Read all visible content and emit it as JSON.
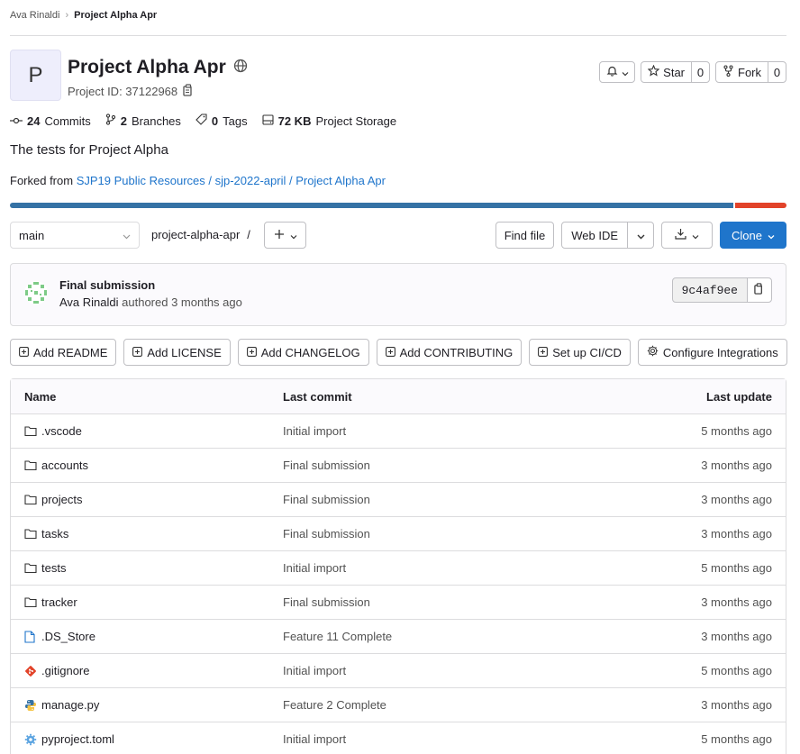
{
  "breadcrumb": {
    "user": "Ava Rinaldi",
    "separator": "›",
    "current": "Project Alpha Apr"
  },
  "project": {
    "avatar_letter": "P",
    "title": "Project Alpha Apr",
    "id_label": "Project ID: 37122968",
    "description": "The tests for Project Alpha",
    "forked_label": "Forked from ",
    "forked_link": "SJP19 Public Resources / sjp-2022-april / Project Alpha Apr"
  },
  "actions": {
    "star_label": "Star",
    "star_count": "0",
    "fork_label": "Fork",
    "fork_count": "0"
  },
  "stats": {
    "commits_count": "24",
    "commits_label": "Commits",
    "branches_count": "2",
    "branches_label": "Branches",
    "tags_count": "0",
    "tags_label": "Tags",
    "storage_count": "72 KB",
    "storage_label": "Project Storage"
  },
  "toolbar": {
    "branch": "main",
    "path": "project-alpha-apr",
    "path_sep": "/",
    "find_file": "Find file",
    "web_ide": "Web IDE",
    "clone": "Clone"
  },
  "commit": {
    "title": "Final submission",
    "author": "Ava Rinaldi",
    "meta": " authored 3 months ago",
    "sha": "9c4af9ee"
  },
  "quick_actions": [
    {
      "label": "Add README",
      "icon": "plus-square-icon"
    },
    {
      "label": "Add LICENSE",
      "icon": "plus-square-icon"
    },
    {
      "label": "Add CHANGELOG",
      "icon": "plus-square-icon"
    },
    {
      "label": "Add CONTRIBUTING",
      "icon": "plus-square-icon"
    },
    {
      "label": "Set up CI/CD",
      "icon": "plus-square-icon"
    },
    {
      "label": "Configure Integrations",
      "icon": "gear-icon"
    }
  ],
  "files": {
    "headers": {
      "name": "Name",
      "commit": "Last commit",
      "update": "Last update"
    },
    "rows": [
      {
        "name": ".vscode",
        "type": "folder",
        "commit": "Initial import",
        "update": "5 months ago"
      },
      {
        "name": "accounts",
        "type": "folder",
        "commit": "Final submission",
        "update": "3 months ago"
      },
      {
        "name": "projects",
        "type": "folder",
        "commit": "Final submission",
        "update": "3 months ago"
      },
      {
        "name": "tasks",
        "type": "folder",
        "commit": "Final submission",
        "update": "3 months ago"
      },
      {
        "name": "tests",
        "type": "folder",
        "commit": "Initial import",
        "update": "5 months ago"
      },
      {
        "name": "tracker",
        "type": "folder",
        "commit": "Final submission",
        "update": "3 months ago"
      },
      {
        "name": ".DS_Store",
        "type": "file",
        "commit": "Feature 11 Complete",
        "update": "3 months ago"
      },
      {
        "name": ".gitignore",
        "type": "git",
        "commit": "Initial import",
        "update": "5 months ago"
      },
      {
        "name": "manage.py",
        "type": "python",
        "commit": "Feature 2 Complete",
        "update": "3 months ago"
      },
      {
        "name": "pyproject.toml",
        "type": "config",
        "commit": "Initial import",
        "update": "5 months ago"
      }
    ]
  },
  "colors": {
    "python": "#3572a5",
    "other": "#e24329",
    "link": "#1f75cb"
  }
}
